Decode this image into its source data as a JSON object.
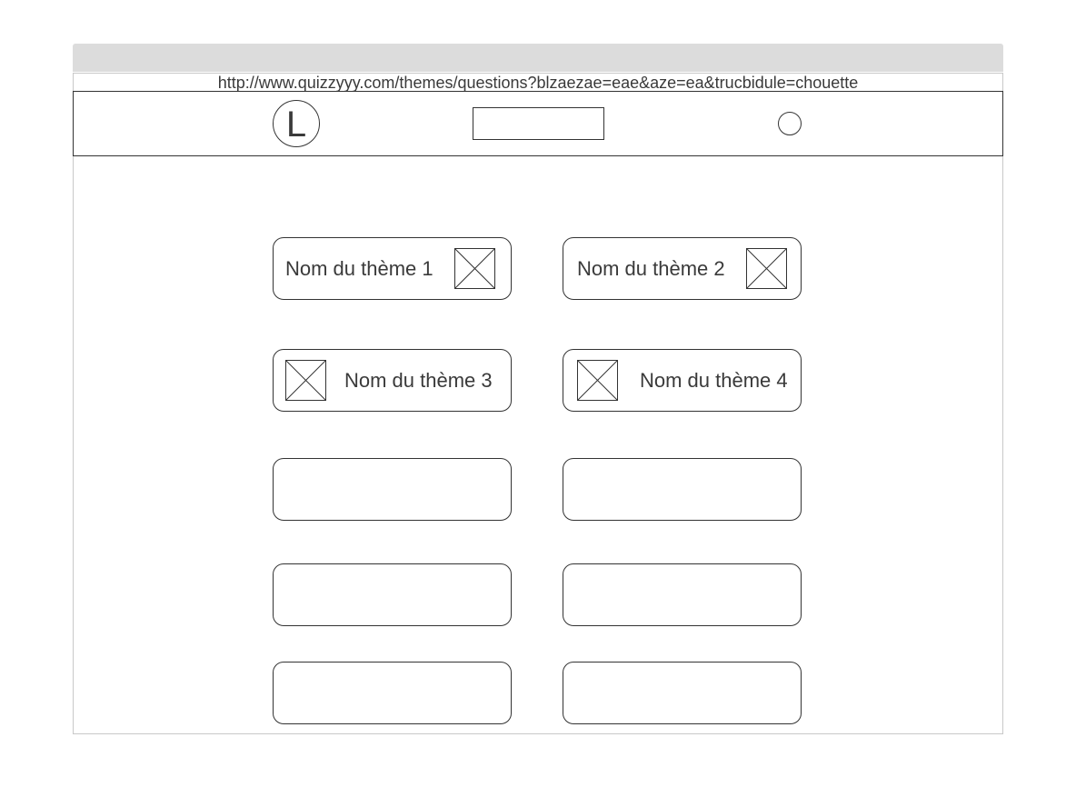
{
  "browser": {
    "url": "http://www.quizzyyy.com/themes/questions?blzaezae=eae&aze=ea&trucbidule=chouette"
  },
  "header": {
    "logo_letter": "L",
    "search_value": "",
    "user_icon": "user-circle-icon"
  },
  "themes": [
    {
      "label": "Nom du thème 1",
      "image": "image-placeholder-icon"
    },
    {
      "label": "Nom du thème 2",
      "image": "image-placeholder-icon"
    },
    {
      "label": "Nom du thème 3",
      "image": "image-placeholder-icon"
    },
    {
      "label": "Nom du thème 4",
      "image": "image-placeholder-icon"
    },
    {
      "label": ""
    },
    {
      "label": ""
    },
    {
      "label": ""
    },
    {
      "label": ""
    },
    {
      "label": ""
    },
    {
      "label": ""
    }
  ],
  "colors": {
    "stroke": "#333333",
    "text": "#3a3a3a",
    "titlebar": "#dcdcdc"
  }
}
